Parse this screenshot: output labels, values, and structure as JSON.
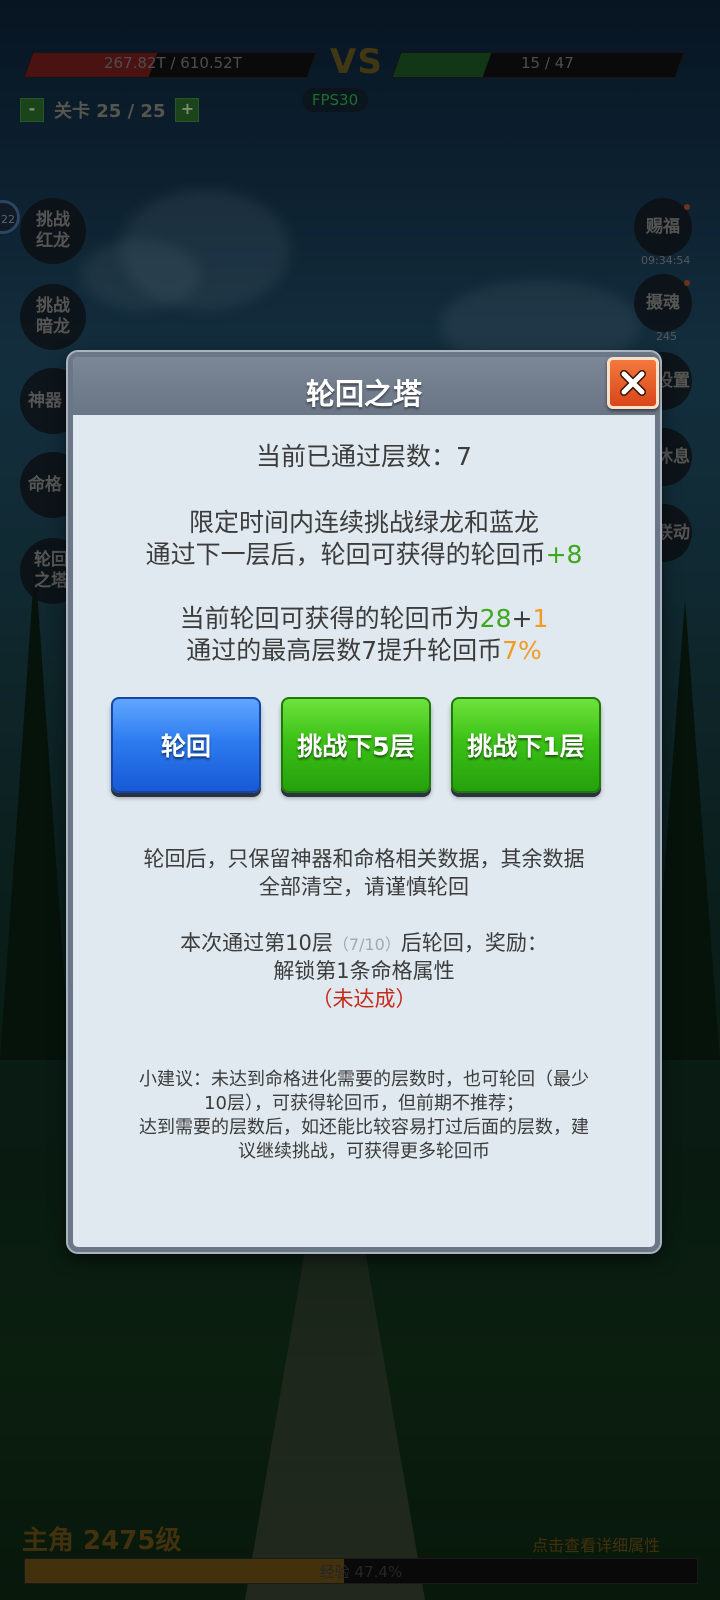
{
  "hud": {
    "left_hp_text": "267.82T / 610.52T",
    "left_hp_fraction": 0.44,
    "vs_label": "VS",
    "right_hp_text": "15 / 47",
    "right_hp_fraction": 0.32,
    "fps_label": "FPS30",
    "level_minus": "-",
    "level_text": "关卡 25 / 25",
    "level_plus": "+"
  },
  "left_buttons": [
    {
      "label": "挑战\n红龙"
    },
    {
      "label": "挑战\n暗龙"
    },
    {
      "label": "神器"
    },
    {
      "label": "命格"
    },
    {
      "label": "轮回\n之塔"
    }
  ],
  "left_badge": "22",
  "right_buttons": [
    {
      "label": "赐福",
      "sub": "09:34:54"
    },
    {
      "label": "摄魂",
      "sub": "245"
    },
    {
      "label": "设置"
    },
    {
      "label": "休息"
    },
    {
      "label": "联动"
    }
  ],
  "bottom": {
    "hero_level": "主角 2475级",
    "detail_link": "点击查看详细属性",
    "exp_text": "经验 47.4%",
    "exp_fraction": 0.474
  },
  "dialog": {
    "title": "轮回之塔",
    "current_floor": "当前已通过层数：7",
    "desc_line1": "限定时间内连续挑战绿龙和蓝龙",
    "desc_line2_prefix": "通过下一层后，轮回可获得的轮回币",
    "desc_line2_bonus": "+8",
    "coins_prefix": "当前轮回可获得的轮回币为",
    "coins_base": "28",
    "coins_plus": "+",
    "coins_extra": "1",
    "max_floor_prefix": "通过的最高层数7提升轮回币",
    "max_floor_percent": "7%",
    "buttons": {
      "reincarnate": "轮回",
      "challenge5": "挑战下5层",
      "challenge1": "挑战下1层"
    },
    "warning_line1": "轮回后，只保留神器和命格相关数据，其余数据",
    "warning_line2": "全部清空，请谨慎轮回",
    "reward_prefix": "本次通过第10层",
    "reward_progress": "（7/10）",
    "reward_suffix": "后轮回，奖励：",
    "reward_item": "解锁第1条命格属性",
    "reward_status": "（未达成）",
    "tip_line1": "小建议：未达到命格进化需要的层数时，也可轮回（最少",
    "tip_line2": "10层），可获得轮回币，但前期不推荐；",
    "tip_line3": "达到需要的层数后，如还能比较容易打过后面的层数，建",
    "tip_line4": "议继续挑战，可获得更多轮回币"
  },
  "colors": {
    "accent_green": "#3da81d",
    "accent_orange": "#f29a22",
    "status_red": "#c72a1c",
    "button_blue": "#2e7cf0",
    "button_green": "#3cc217"
  }
}
